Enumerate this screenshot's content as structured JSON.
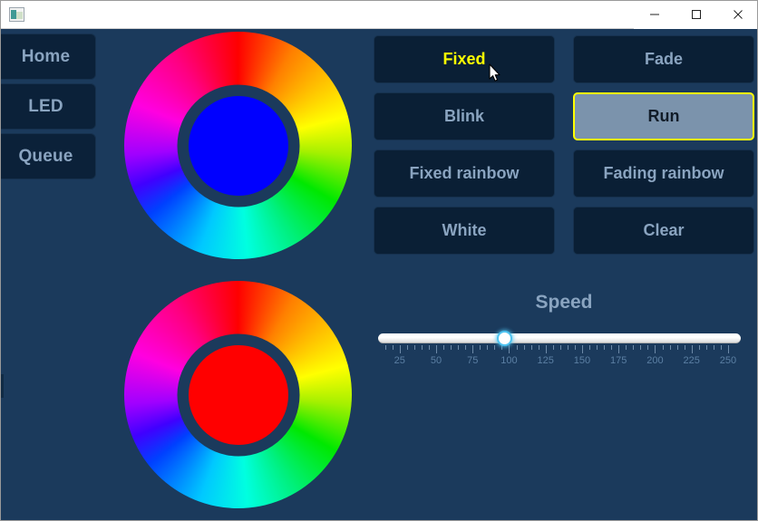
{
  "window": {
    "title": "",
    "icon": "app-window-icon",
    "controls": {
      "minimize": "minimize-icon",
      "maximize": "maximize-icon",
      "close": "close-icon"
    },
    "background_color": "#1b3a5c"
  },
  "sidebar": {
    "items": [
      {
        "label": "Home"
      },
      {
        "label": "LED"
      },
      {
        "label": "Queue"
      }
    ]
  },
  "wheels": [
    {
      "name": "primary-color-wheel",
      "selected_color": "#0000ff"
    },
    {
      "name": "secondary-color-wheel",
      "selected_color": "#ff0000"
    }
  ],
  "modes": {
    "buttons": [
      {
        "label": "Fixed",
        "state": "active",
        "text_color": "#ffff00"
      },
      {
        "label": "Fade",
        "state": "normal",
        "text_color": "#8aa4c0"
      },
      {
        "label": "Blink",
        "state": "normal",
        "text_color": "#8aa4c0"
      },
      {
        "label": "Run",
        "state": "selected",
        "text_color": "#111c28"
      },
      {
        "label": "Fixed rainbow",
        "state": "normal",
        "text_color": "#8aa4c0"
      },
      {
        "label": "Fading rainbow",
        "state": "normal",
        "text_color": "#8aa4c0"
      },
      {
        "label": "White",
        "state": "normal",
        "text_color": "#8aa4c0"
      },
      {
        "label": "Clear",
        "state": "normal",
        "text_color": "#8aa4c0"
      }
    ]
  },
  "speed": {
    "title": "Speed",
    "value": 97,
    "min": 14,
    "max": 255,
    "tick_labels": [
      "25",
      "50",
      "75",
      "100",
      "125",
      "150",
      "175",
      "200",
      "225",
      "250"
    ]
  },
  "cursor": {
    "name": "mouse-pointer"
  }
}
